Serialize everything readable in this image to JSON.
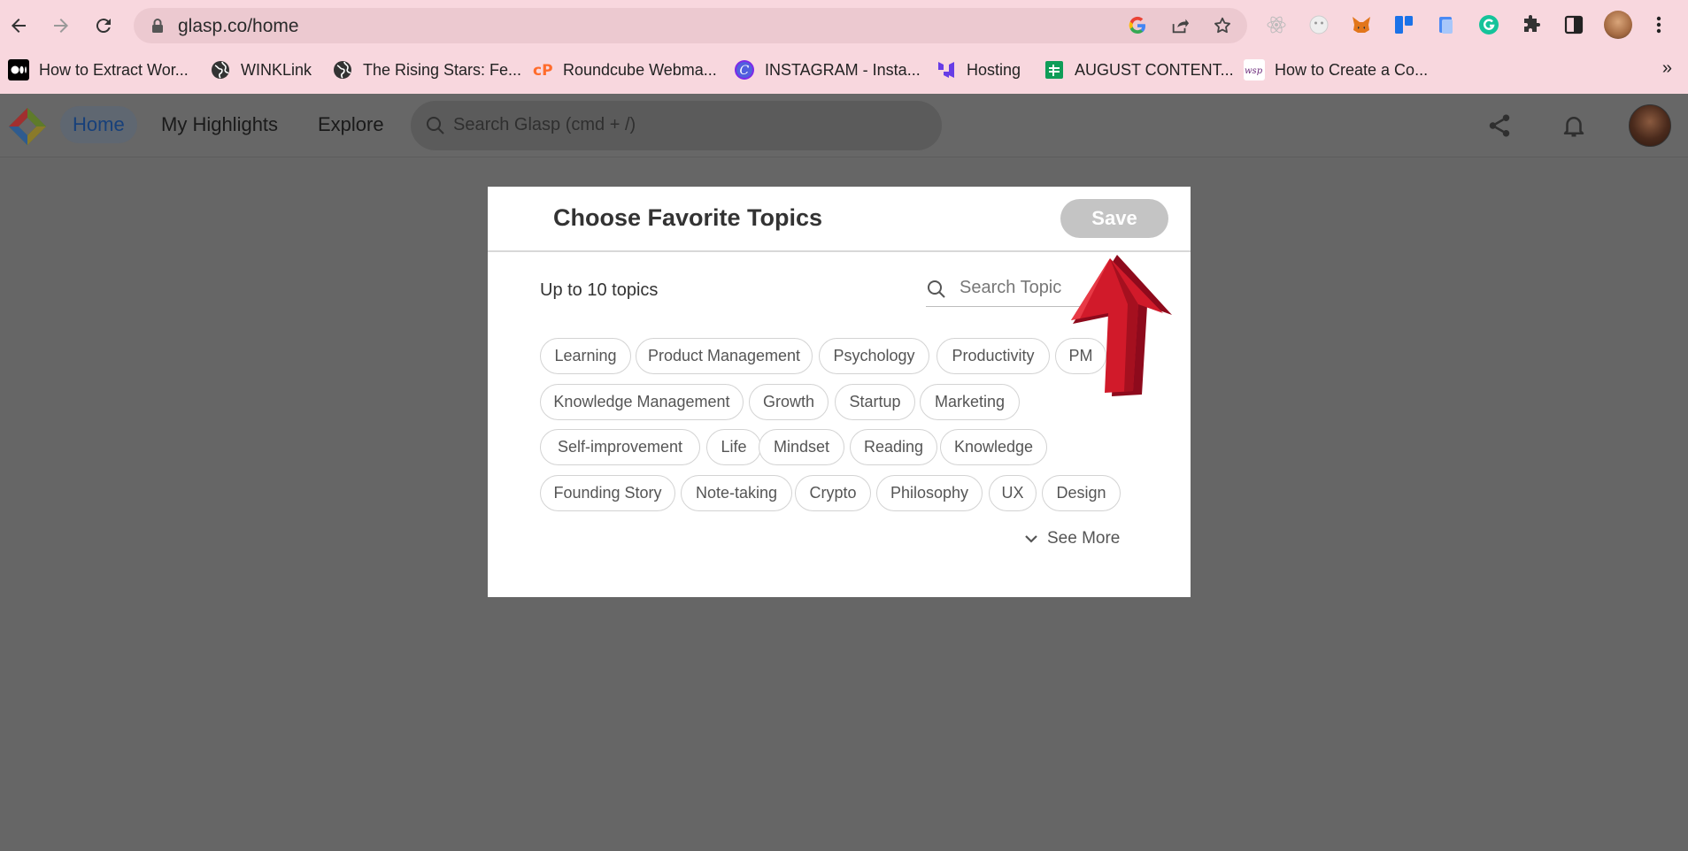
{
  "browser": {
    "url": "glasp.co/home",
    "bookmarks": [
      {
        "label": "How to Extract Wor...",
        "icon": "medium-icon"
      },
      {
        "label": "WINKLink",
        "icon": "globe-icon"
      },
      {
        "label": "The Rising Stars: Fe...",
        "icon": "globe-icon"
      },
      {
        "label": "Roundcube Webma...",
        "icon": "cpanel-icon"
      },
      {
        "label": "INSTAGRAM - Insta...",
        "icon": "canva-icon"
      },
      {
        "label": "Hosting",
        "icon": "hostinger-icon"
      },
      {
        "label": "AUGUST CONTENT...",
        "icon": "sheets-icon"
      },
      {
        "label": "How to Create a Co...",
        "icon": "wsp-icon"
      }
    ],
    "more_bookmarks": "»"
  },
  "app": {
    "nav": [
      {
        "label": "Home",
        "active": true
      },
      {
        "label": "My Highlights",
        "active": false
      },
      {
        "label": "Explore",
        "active": false
      }
    ],
    "search_placeholder": "Search Glasp (cmd + /)"
  },
  "modal": {
    "title": "Choose Favorite Topics",
    "save_label": "Save",
    "limit_text": "Up to 10 topics",
    "search_placeholder": "Search Topic",
    "topics": [
      [
        "Learning",
        "Product Management",
        "Psychology",
        "Productivity",
        "PM"
      ],
      [
        "Knowledge Management",
        "Growth",
        "Startup",
        "Marketing"
      ],
      [
        "Self-improvement",
        "Life",
        "Mindset",
        "Reading",
        "Knowledge"
      ],
      [
        "Founding Story",
        "Note-taking",
        "Crypto",
        "Philosophy",
        "UX",
        "Design"
      ]
    ],
    "see_more_label": "See More"
  },
  "colors": {
    "chrome_bg": "#f8d7de",
    "overlay": "#666666",
    "save_disabled": "#c4c4c4",
    "arrow_red": "#c8102e"
  }
}
